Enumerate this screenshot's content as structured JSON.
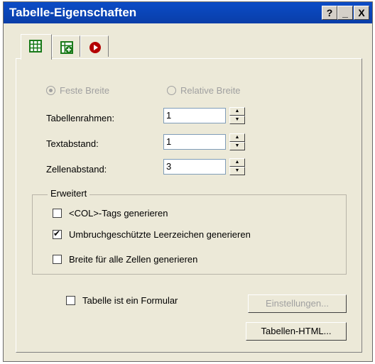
{
  "window": {
    "title": "Tabelle-Eigenschaften",
    "help_label": "?",
    "minimize_label": "_",
    "close_label": "X"
  },
  "tabs": [
    {
      "icon": "table-grid-icon"
    },
    {
      "icon": "table-add-icon"
    },
    {
      "icon": "record-circle-icon"
    }
  ],
  "width_mode": {
    "fixed_label": "Feste Breite",
    "relative_label": "Relative Breite"
  },
  "fields": {
    "border_label": "Tabellenrahmen:",
    "border_value": "1",
    "padding_label": "Textabstand:",
    "padding_value": "1",
    "spacing_label": "Zellenabstand:",
    "spacing_value": "3"
  },
  "advanced": {
    "title": "Erweitert",
    "col_tags_label": "<COL>-Tags generieren",
    "nbsp_label": "Umbruchgeschützte Leerzeichen generieren",
    "width_all_label": "Breite für alle Zellen generieren"
  },
  "form": {
    "is_form_label": "Tabelle ist ein Formular"
  },
  "buttons": {
    "settings_label": "Einstellungen...",
    "html_label": "Tabellen-HTML..."
  },
  "colors": {
    "titlebar": "#0a3ea8",
    "dialog_bg": "#ece9d8",
    "disabled_text": "#a0a0a0"
  }
}
